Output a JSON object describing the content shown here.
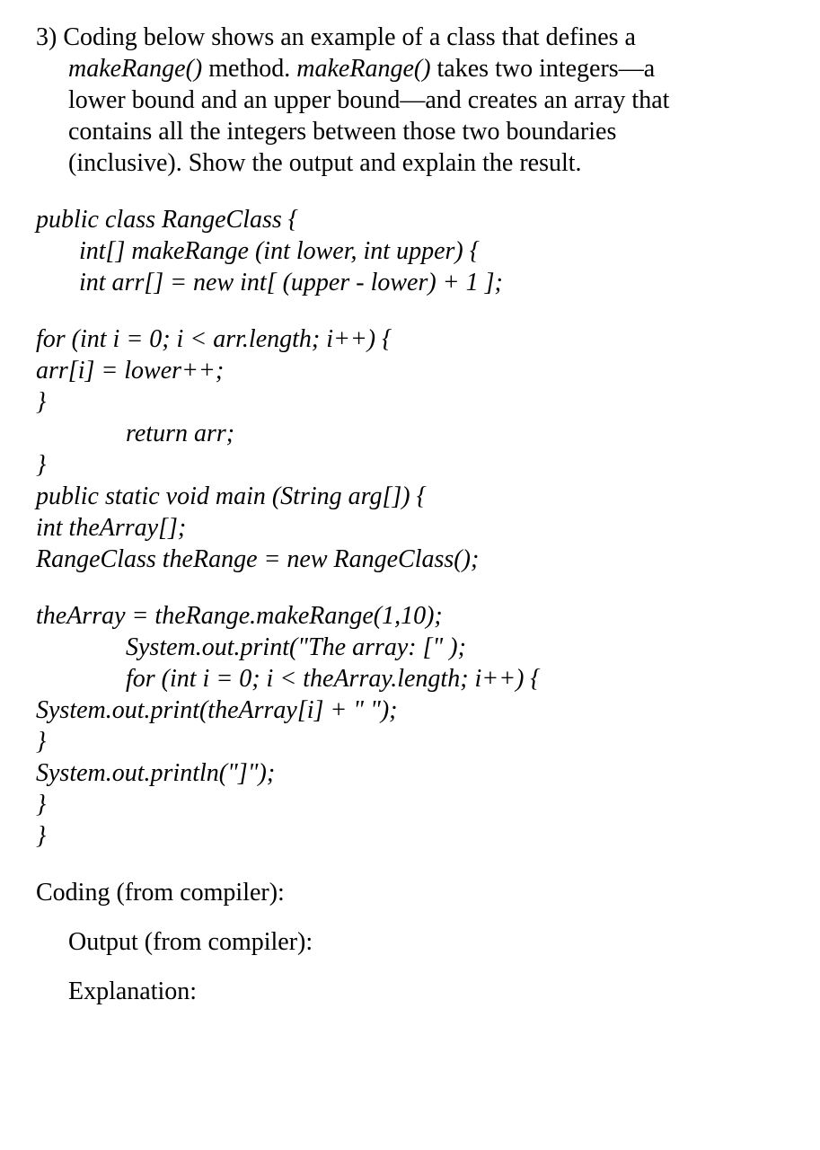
{
  "question": {
    "number": "3)",
    "line1": "Coding below shows an example of a class that defines a",
    "line2_pre": "makeRange()",
    "line2_mid": " method. ",
    "line2_ital": "makeRange()",
    "line2_post": " takes two integers—a",
    "line3": "lower bound and an upper bound—and creates an array that",
    "line4": "contains all the integers between those two boundaries",
    "line5": "(inclusive). Show the output and explain the result."
  },
  "code": {
    "l1": "public class RangeClass {",
    "l2": "int[] makeRange (int lower, int upper) {",
    "l3": "int arr[] = new int[ (upper - lower) + 1 ];",
    "l4": "for (int i = 0; i < arr.length; i++) {",
    "l5": "arr[i] = lower++;",
    "l6": "}",
    "l7": "return arr;",
    "l8": "}",
    "l9": "public static void main (String arg[]) {",
    "l10": "int theArray[];",
    "l11": "RangeClass theRange = new RangeClass();",
    "l12": "theArray = theRange.makeRange(1,10);",
    "l13": "System.out.print(\"The array: [\" );",
    "l14": "for (int i = 0; i < theArray.length; i++) {",
    "l15": "System.out.print(theArray[i] + \" \");",
    "l16": "}",
    "l17": "System.out.println(\"]\");",
    "l18": "}",
    "l19": "}"
  },
  "labels": {
    "coding": "Coding (from compiler):",
    "output": "Output (from compiler):",
    "explanation": "Explanation:"
  }
}
